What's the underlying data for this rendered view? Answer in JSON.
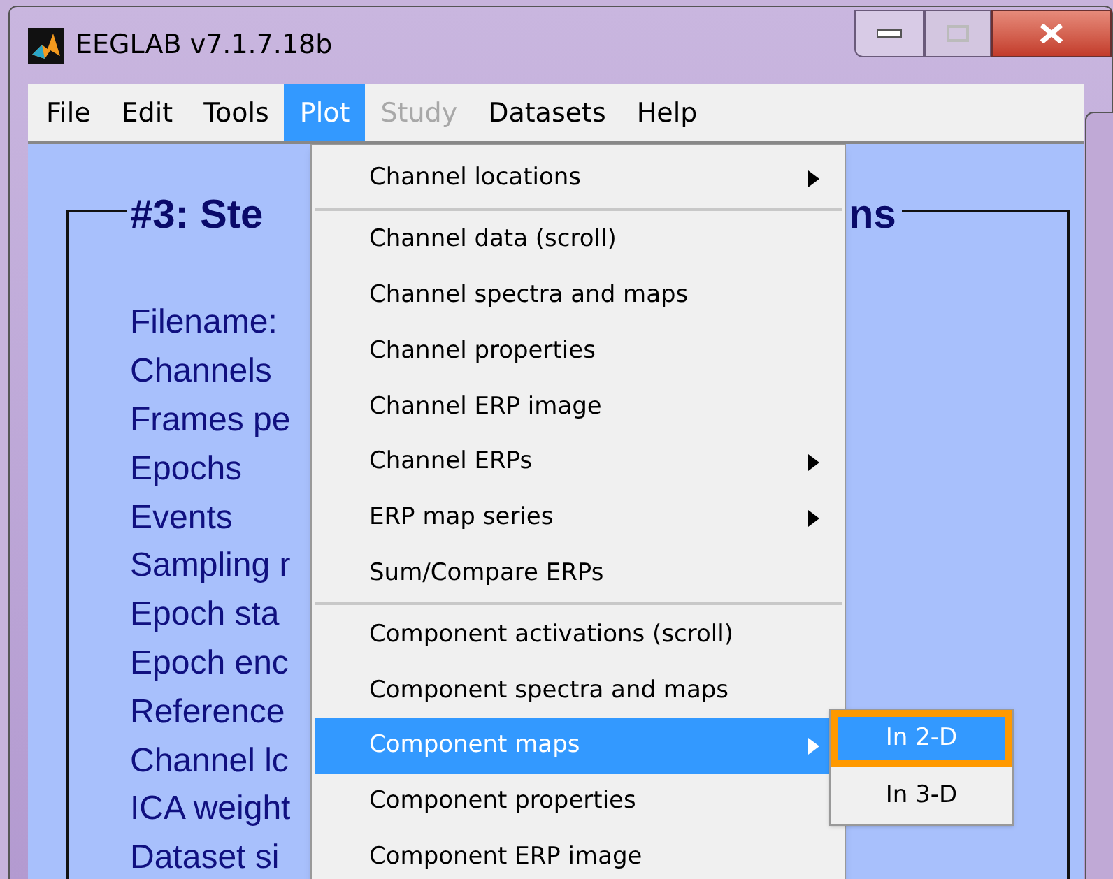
{
  "window": {
    "title": "EEGLAB v7.1.7.18b"
  },
  "menubar": [
    {
      "label": "File",
      "selected": false,
      "disabled": false
    },
    {
      "label": "Edit",
      "selected": false,
      "disabled": false
    },
    {
      "label": "Tools",
      "selected": false,
      "disabled": false
    },
    {
      "label": "Plot",
      "selected": true,
      "disabled": false
    },
    {
      "label": "Study",
      "selected": false,
      "disabled": true
    },
    {
      "label": "Datasets",
      "selected": false,
      "disabled": false
    },
    {
      "label": "Help",
      "selected": false,
      "disabled": false
    }
  ],
  "panel": {
    "title_left": "#3: Ste",
    "title_right": "ns",
    "fields": [
      "Filename:",
      "Channels",
      "Frames pe",
      "Epochs",
      "Events",
      "Sampling r",
      "Epoch sta",
      "Epoch enc",
      "Reference",
      "Channel lc",
      "ICA weight",
      "Dataset si"
    ]
  },
  "plot_menu": {
    "groups": [
      [
        {
          "label": "Channel locations",
          "selected": false,
          "has_submenu": true
        }
      ],
      [
        {
          "label": "Channel data (scroll)",
          "selected": false,
          "has_submenu": false
        },
        {
          "label": "Channel spectra and maps",
          "selected": false,
          "has_submenu": false
        },
        {
          "label": "Channel properties",
          "selected": false,
          "has_submenu": false
        },
        {
          "label": "Channel ERP image",
          "selected": false,
          "has_submenu": false
        },
        {
          "label": "Channel ERPs",
          "selected": false,
          "has_submenu": true
        },
        {
          "label": "ERP map series",
          "selected": false,
          "has_submenu": true
        },
        {
          "label": "Sum/Compare ERPs",
          "selected": false,
          "has_submenu": false
        }
      ],
      [
        {
          "label": "Component activations (scroll)",
          "selected": false,
          "has_submenu": false
        },
        {
          "label": "Component spectra and maps",
          "selected": false,
          "has_submenu": false
        },
        {
          "label": "Component maps",
          "selected": true,
          "has_submenu": true
        },
        {
          "label": "Component properties",
          "selected": false,
          "has_submenu": false
        },
        {
          "label": "Component ERP image",
          "selected": false,
          "has_submenu": false
        }
      ]
    ]
  },
  "submenu": [
    {
      "label": "In 2-D",
      "selected": true,
      "highlighted": true
    },
    {
      "label": "In 3-D",
      "selected": false,
      "highlighted": false
    }
  ]
}
